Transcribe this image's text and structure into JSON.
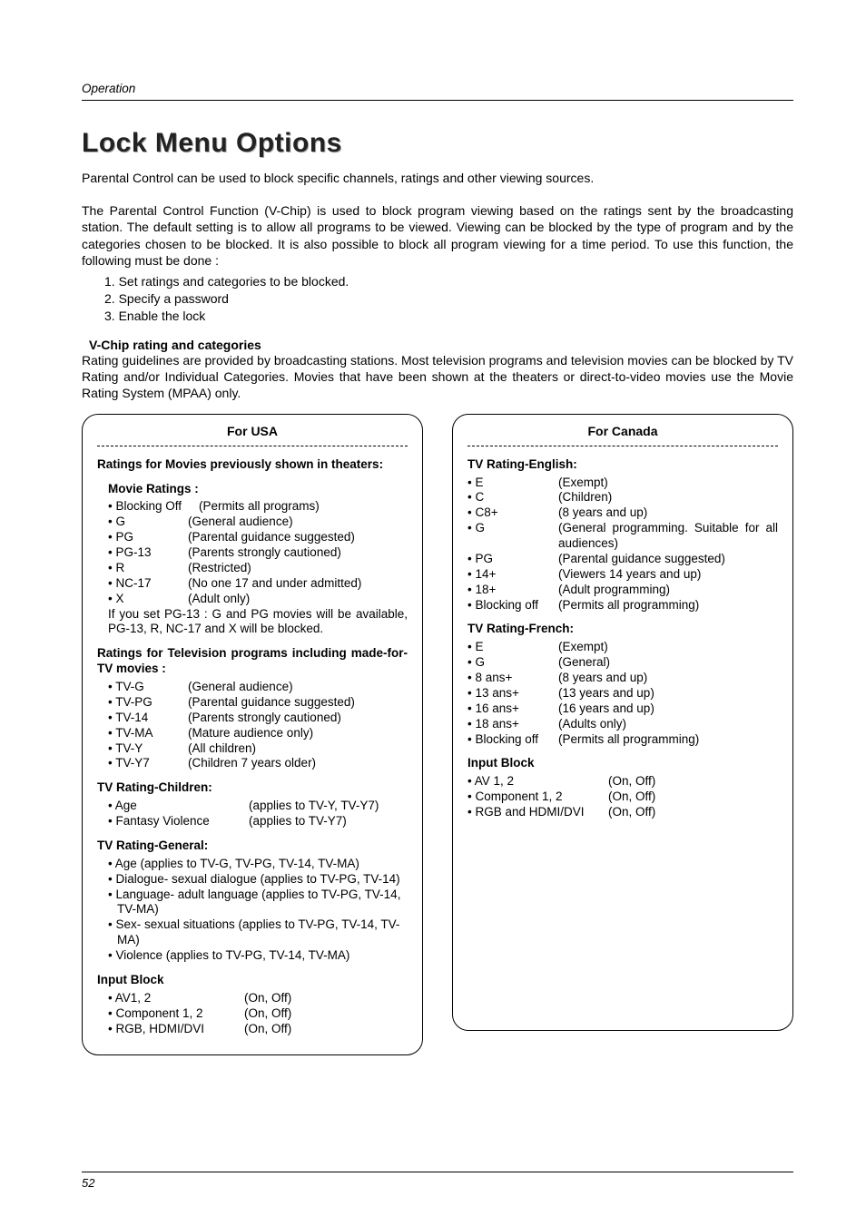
{
  "header": {
    "section": "Operation"
  },
  "title": "Lock Menu Options",
  "intro": "Parental Control can be used to block specific channels, ratings and other viewing sources.",
  "para1": "The Parental Control Function (V-Chip) is used to block program viewing based on the ratings sent by the broadcasting station. The default setting is to allow all programs to be viewed. Viewing can be blocked by the type of program and by the categories chosen to be blocked. It is also possible to block all program viewing for a time period. To use this function, the following must be done :",
  "steps": [
    "1. Set ratings and categories to be blocked.",
    "2. Specify a password",
    "3. Enable the lock"
  ],
  "vchip_heading": "V-Chip rating and categories",
  "vchip_para": "Rating guidelines are provided by broadcasting stations. Most television programs and television movies can be blocked by TV Rating and/or Individual Categories. Movies that have been shown at the theaters or direct-to-video movies use the Movie Rating System (MPAA) only.",
  "usa": {
    "box_title": "For USA",
    "movies_heading": "Ratings for Movies previously shown in theaters:",
    "movie_ratings_label": "Movie Ratings :",
    "movie_ratings": [
      {
        "label": "• Blocking Off",
        "desc": "(Permits all programs)"
      },
      {
        "label": "• G",
        "desc": "(General audience)"
      },
      {
        "label": "• PG",
        "desc": "(Parental guidance suggested)"
      },
      {
        "label": "• PG-13",
        "desc": "(Parents strongly cautioned)"
      },
      {
        "label": "• R",
        "desc": "(Restricted)"
      },
      {
        "label": "• NC-17",
        "desc": "(No one 17 and under admitted)"
      },
      {
        "label": "• X",
        "desc": "(Adult only)"
      }
    ],
    "movie_note": "If you set PG-13 : G and PG movies will be available, PG-13, R, NC-17 and X will be blocked.",
    "tv_heading": "Ratings for Television programs including made-for-TV movies :",
    "tv_ratings": [
      {
        "label": "• TV-G",
        "desc": "(General audience)"
      },
      {
        "label": "• TV-PG",
        "desc": "(Parental guidance suggested)"
      },
      {
        "label": "• TV-14",
        "desc": "(Parents strongly cautioned)"
      },
      {
        "label": "• TV-MA",
        "desc": "(Mature audience only)"
      },
      {
        "label": "• TV-Y",
        "desc": "(All children)"
      },
      {
        "label": "• TV-Y7",
        "desc": "(Children 7 years older)"
      }
    ],
    "children_heading": "TV Rating-Children:",
    "children": [
      {
        "label": "• Age",
        "desc": "(applies to TV-Y, TV-Y7)"
      },
      {
        "label": "• Fantasy Violence",
        "desc": "(applies to TV-Y7)"
      }
    ],
    "general_heading": "TV Rating-General:",
    "general": [
      "• Age (applies to TV-G, TV-PG, TV-14, TV-MA)",
      "• Dialogue- sexual dialogue (applies to TV-PG, TV-14)",
      "• Language- adult language (applies to TV-PG, TV-14, TV-MA)",
      "• Sex- sexual situations (applies to TV-PG, TV-14, TV-MA)",
      "• Violence (applies to TV-PG, TV-14, TV-MA)"
    ],
    "input_heading": "Input Block",
    "inputs": [
      {
        "label": "• AV1, 2",
        "desc": "(On, Off)"
      },
      {
        "label": "• Component 1, 2",
        "desc": "(On, Off)"
      },
      {
        "label": "• RGB, HDMI/DVI",
        "desc": "(On, Off)"
      }
    ]
  },
  "canada": {
    "box_title": "For Canada",
    "eng_heading": "TV Rating-English:",
    "eng": [
      {
        "label": "• E",
        "desc": "(Exempt)"
      },
      {
        "label": "• C",
        "desc": "(Children)"
      },
      {
        "label": "• C8+",
        "desc": "(8 years and up)"
      },
      {
        "label": "• G",
        "desc": "(General programming. Suitable for all audiences)"
      },
      {
        "label": "• PG",
        "desc": "(Parental guidance suggested)"
      },
      {
        "label": "• 14+",
        "desc": "(Viewers 14 years and up)"
      },
      {
        "label": "• 18+",
        "desc": "(Adult programming)"
      },
      {
        "label": "• Blocking off",
        "desc": "(Permits all programming)"
      }
    ],
    "fr_heading": "TV Rating-French:",
    "fr": [
      {
        "label": "• E",
        "desc": "(Exempt)"
      },
      {
        "label": "• G",
        "desc": "(General)"
      },
      {
        "label": "• 8 ans+",
        "desc": "(8 years and up)"
      },
      {
        "label": "• 13 ans+",
        "desc": "(13 years and up)"
      },
      {
        "label": "• 16 ans+",
        "desc": "(16 years and up)"
      },
      {
        "label": "• 18 ans+",
        "desc": "(Adults only)"
      },
      {
        "label": "• Blocking off",
        "desc": "(Permits all programming)"
      }
    ],
    "input_heading": "Input Block",
    "inputs": [
      {
        "label": "• AV 1, 2",
        "desc": "(On, Off)"
      },
      {
        "label": "• Component 1, 2",
        "desc": "(On, Off)"
      },
      {
        "label": "• RGB and HDMI/DVI",
        "desc": "(On, Off)"
      }
    ]
  },
  "page_number": "52"
}
